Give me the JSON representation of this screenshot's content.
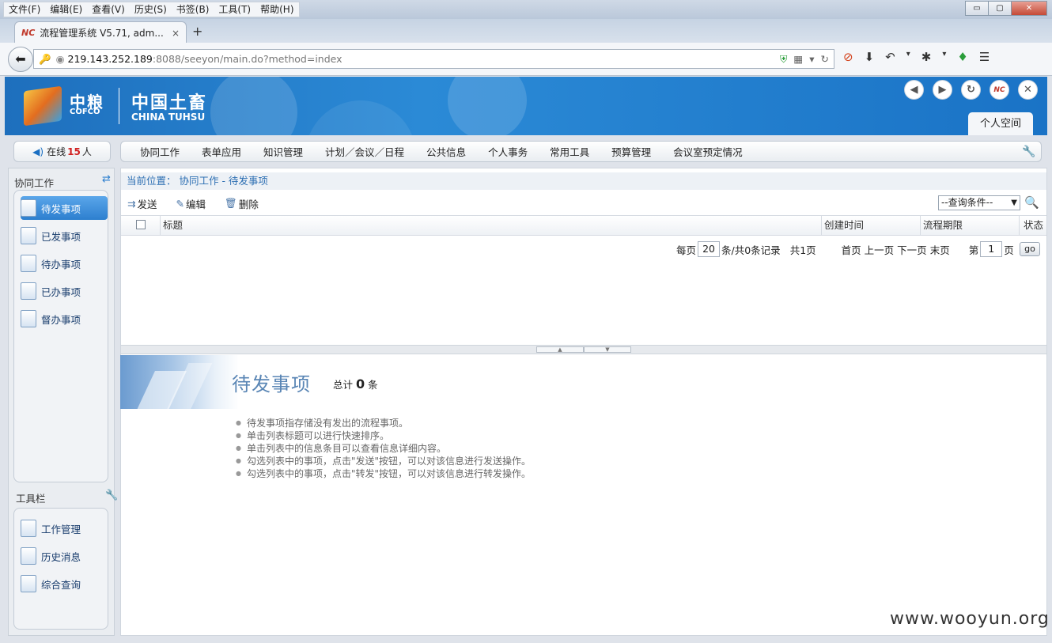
{
  "menu": [
    "文件(F)",
    "编辑(E)",
    "查看(V)",
    "历史(S)",
    "书签(B)",
    "工具(T)",
    "帮助(H)"
  ],
  "window": {
    "minimize": "▭",
    "maximize": "▢",
    "close": "✕"
  },
  "tab": {
    "fav": "NC",
    "title": "流程管理系统 V5.71, adm...",
    "close": "×",
    "newtab": "+"
  },
  "url": {
    "host": "219.143.252.189",
    "rest": ":8088/seeyon/main.do?method=index"
  },
  "header": {
    "logo_cn": "中粮",
    "logo_en": "COFCO",
    "brand_cn": "中国土畜",
    "brand_en": "CHINA TUHSU",
    "space_tab": "个人空间",
    "icons": {
      "back": "◀",
      "forward": "▶",
      "refresh": "↻",
      "nc": "NC",
      "close": "✕"
    }
  },
  "online": {
    "label": "在线",
    "count": "15",
    "unit": "人",
    "icon": "◀)"
  },
  "nav": [
    "协同工作",
    "表单应用",
    "知识管理",
    "计划／会议／日程",
    "公共信息",
    "个人事务",
    "常用工具",
    "预算管理",
    "会议室预定情况"
  ],
  "sidebar": {
    "title1": "协同工作",
    "items": [
      "待发事项",
      "已发事项",
      "待办事项",
      "已办事项",
      "督办事项"
    ],
    "title2": "工具栏",
    "tools": [
      "工作管理",
      "历史消息",
      "综合查询"
    ]
  },
  "breadcrumb": "当前位置： 协同工作 - 待发事项",
  "toolbar": {
    "send": "发送",
    "edit": "编辑",
    "delete": "删除"
  },
  "query": {
    "select": "--查询条件--"
  },
  "table": {
    "title": "标题",
    "created": "创建时间",
    "deadline": "流程期限",
    "status": "状态"
  },
  "pager": {
    "per": "每页",
    "size": "20",
    "records": "条/共0条记录",
    "total": "共1页",
    "first": "首页",
    "prev": "上一页",
    "next": "下一页",
    "last": "末页",
    "page_pre": "第",
    "page": "1",
    "page_post": "页",
    "go": "go"
  },
  "panel": {
    "title": "待发事项",
    "total_pre": "总计",
    "total": "0",
    "total_post": "条",
    "tips": [
      "待发事项指存储没有发出的流程事项。",
      "单击列表标题可以进行快速排序。",
      "单击列表中的信息条目可以查看信息详细内容。",
      "勾选列表中的事项，点击\"发送\"按钮，可以对该信息进行发送操作。",
      "勾选列表中的事项，点击\"转发\"按钮，可以对该信息进行转发操作。"
    ]
  },
  "watermark": "www.wooyun.org"
}
